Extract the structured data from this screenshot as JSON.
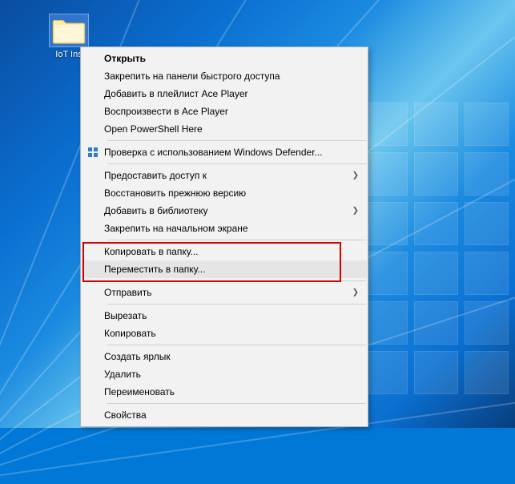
{
  "desktop": {
    "folder_label": "IoT Ins"
  },
  "menu": {
    "open": "Открыть",
    "pin_quick": "Закрепить на панели быстрого доступа",
    "add_playlist": "Добавить в плейлист Ace Player",
    "play_ace": "Воспроизвести в Ace Player",
    "powershell": "Open PowerShell Here",
    "defender": "Проверка с использованием Windows Defender...",
    "grant_access": "Предоставить доступ к",
    "restore_prev": "Восстановить прежнюю версию",
    "add_library": "Добавить в библиотеку",
    "pin_start": "Закрепить на начальном экране",
    "copy_to_folder": "Копировать в папку...",
    "move_to_folder": "Переместить в папку...",
    "send_to": "Отправить",
    "cut": "Вырезать",
    "copy": "Копировать",
    "create_shortcut": "Создать ярлык",
    "delete": "Удалить",
    "rename": "Переименовать",
    "properties": "Свойства"
  },
  "highlight": {
    "items": [
      "copy_to_folder",
      "move_to_folder"
    ]
  }
}
